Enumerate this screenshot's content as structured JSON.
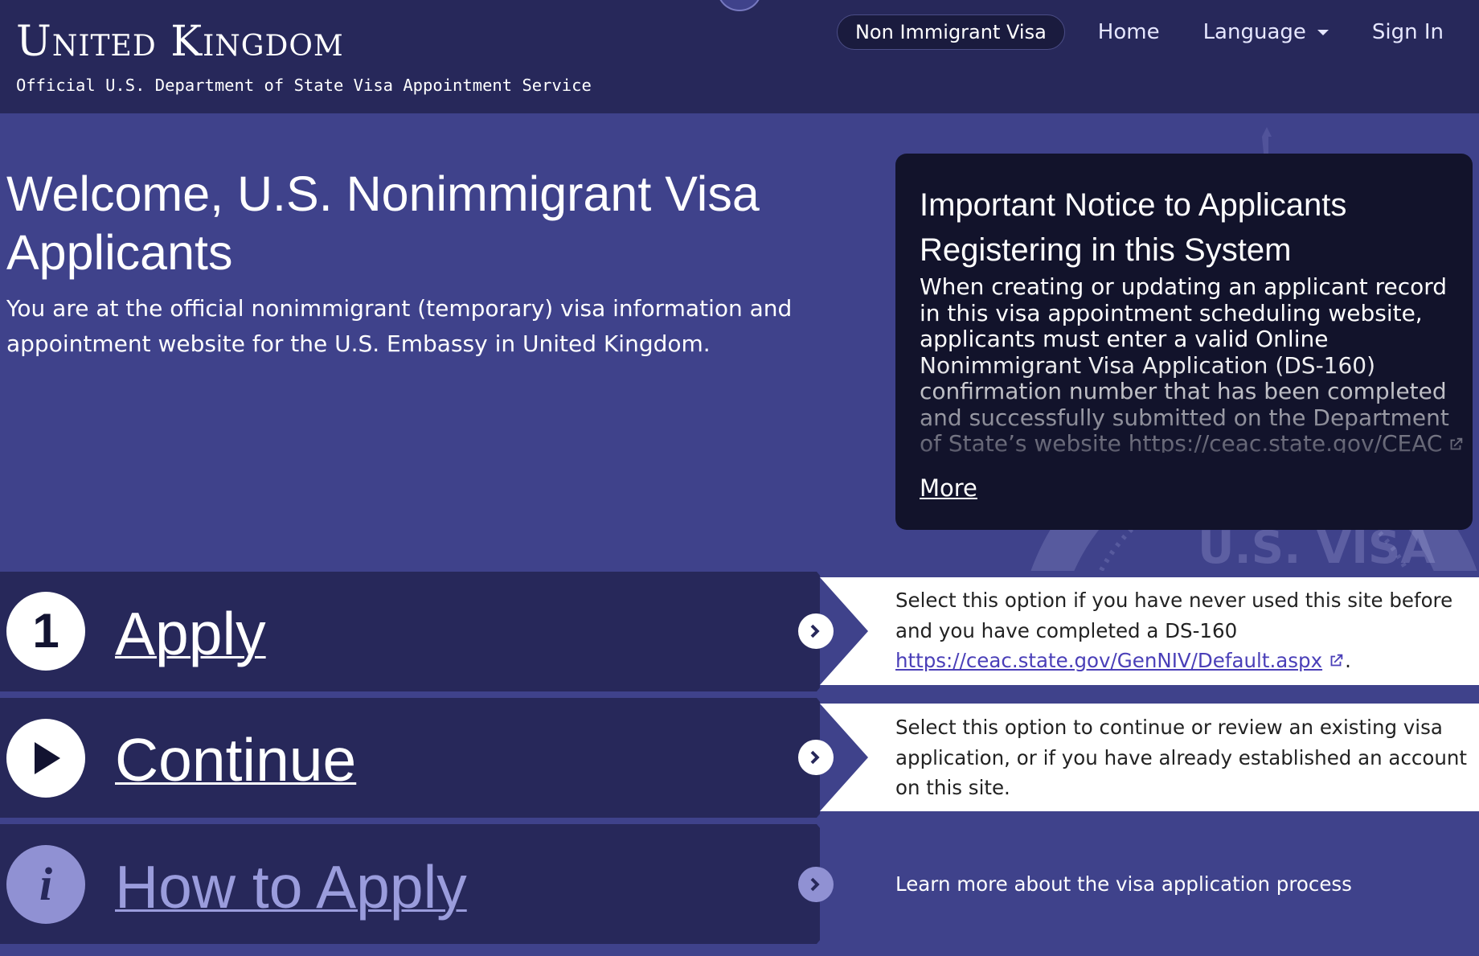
{
  "header": {
    "title": "United Kingdom",
    "subtitle": "Official U.S. Department of State Visa Appointment Service"
  },
  "nav": {
    "active": "Non Immigrant Visa",
    "home": "Home",
    "language": "Language",
    "sign_in": "Sign In"
  },
  "welcome": {
    "title": "Welcome, U.S. Nonimmigrant Visa Applicants",
    "text": "You are at the official nonimmigrant (temporary) visa information and appointment website for the U.S. Embassy in United Kingdom."
  },
  "notice": {
    "title": "Important Notice to Applicants Registering in this System",
    "body": "When creating or updating an applicant record in this visa appointment scheduling website, applicants must enter a valid Online Nonimmigrant Visa Application (DS-160) confirmation number that has been completed and successfully submitted on the Department of State’s website",
    "link": "https://ceac.state.gov/CEAC",
    "link_suffix": ".",
    "more": "More"
  },
  "actions": [
    {
      "icon_text": "1",
      "label": "Apply",
      "description": "Select this option if you have never used this site before and you have completed a DS-160",
      "link": "https://ceac.state.gov/GenNIV/Default.aspx",
      "link_suffix": "."
    },
    {
      "icon": "play-icon",
      "label": "Continue",
      "description": "Select this option to continue or review an existing visa application, or if you have already established an account on this site."
    },
    {
      "icon": "info-icon",
      "icon_text": "i",
      "label": "How to Apply",
      "description": "Learn more about the visa application process"
    }
  ],
  "watermark_text": "U.S. VISA",
  "colors": {
    "header_bg": "#27285a",
    "page_bg": "#3f428b",
    "notice_bg": "#12132b",
    "link": "#4a3fb8"
  }
}
